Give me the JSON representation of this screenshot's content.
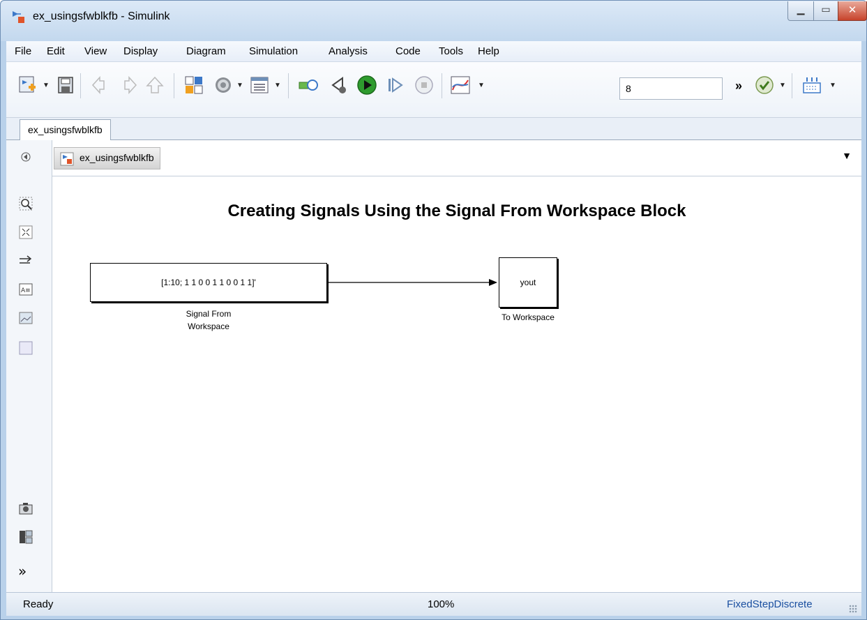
{
  "window": {
    "title": "ex_usingsfwblkfb - Simulink"
  },
  "menu": [
    "File",
    "Edit",
    "View",
    "Display",
    "Diagram",
    "Simulation",
    "Analysis",
    "Code",
    "Tools",
    "Help"
  ],
  "toolbar": {
    "stop_time": "8",
    "more_label": "»"
  },
  "tab": {
    "label": "ex_usingsfwblkfb"
  },
  "address": {
    "path": "ex_usingsfwblkfb"
  },
  "diagram": {
    "title": "Creating Signals Using the Signal From Workspace Block",
    "source_block": {
      "value": "[1:10; 1 1 0 0 1 1 0 0 1 1]'",
      "label_line1": "Signal From",
      "label_line2": "Workspace"
    },
    "sink_block": {
      "value": "yout",
      "label": "To Workspace"
    }
  },
  "status": {
    "ready": "Ready",
    "zoom": "100%",
    "solver": "FixedStepDiscrete"
  },
  "colors": {
    "title_bar": "#c3d8ee",
    "run_green": "#2e9b2e",
    "solver_link": "#1a4fa0"
  }
}
